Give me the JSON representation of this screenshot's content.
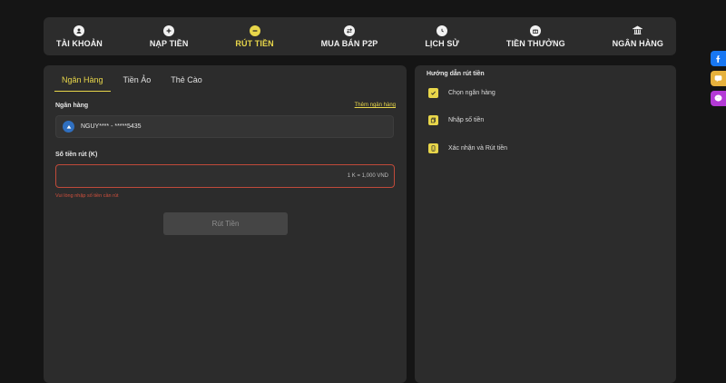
{
  "nav": {
    "items": [
      {
        "label": "TÀI KHOẢN",
        "icon": "user-icon"
      },
      {
        "label": "NẠP TIỀN",
        "icon": "plus-icon"
      },
      {
        "label": "RÚT TIỀN",
        "icon": "minus-icon",
        "active": true
      },
      {
        "label": "MUA BÁN P2P",
        "icon": "swap-icon"
      },
      {
        "label": "LỊCH SỬ",
        "icon": "clock-icon"
      },
      {
        "label": "TIỀN THƯỞNG",
        "icon": "gift-icon"
      },
      {
        "label": "NGÂN HÀNG",
        "icon": "bank-icon"
      }
    ]
  },
  "withdraw": {
    "tabs": [
      "Ngân Hàng",
      "Tiền Ảo",
      "Thẻ Cào"
    ],
    "bank_label": "Ngân hàng",
    "add_bank_link": "Thêm ngân hàng",
    "selected_account": "NGUY**** - *****5435",
    "amount_label": "Số tiền rút (K)",
    "amount_value": "",
    "rate_hint": "1 K = 1,000 VND",
    "error_text": "Vui lòng nhập số tiền cần rút",
    "submit_label": "Rút Tiền"
  },
  "guide": {
    "title": "Hướng dẫn rút tiền",
    "steps": [
      "Chọn ngân hàng",
      "Nhập số tiền",
      "Xác nhận và Rút tiền"
    ]
  },
  "social": [
    "facebook-icon",
    "zalo-icon",
    "messenger-icon"
  ],
  "colors": {
    "accent": "#e8d64a",
    "error": "#d2503d",
    "panel": "#2c2c2c",
    "background": "#151515"
  }
}
